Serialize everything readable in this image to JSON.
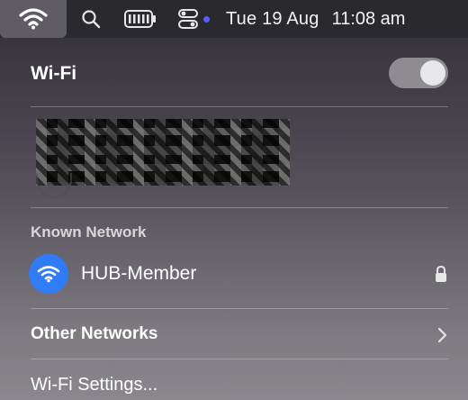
{
  "menubar": {
    "icons": [
      "wifi-icon",
      "search-icon",
      "battery-icon",
      "control-center-icon"
    ],
    "date": "Tue 19 Aug",
    "time": "11:08 am",
    "accent_dot_color": "#5b5df0"
  },
  "wifi_panel": {
    "title": "Wi-Fi",
    "toggle_on": true,
    "known_header": "Known Network",
    "known_networks": [
      {
        "name": "HUB-Member",
        "icon": "wifi-icon",
        "locked": true,
        "icon_color": "#2f7cf6"
      }
    ],
    "other_networks_label": "Other Networks",
    "settings_label": "Wi-Fi Settings..."
  }
}
